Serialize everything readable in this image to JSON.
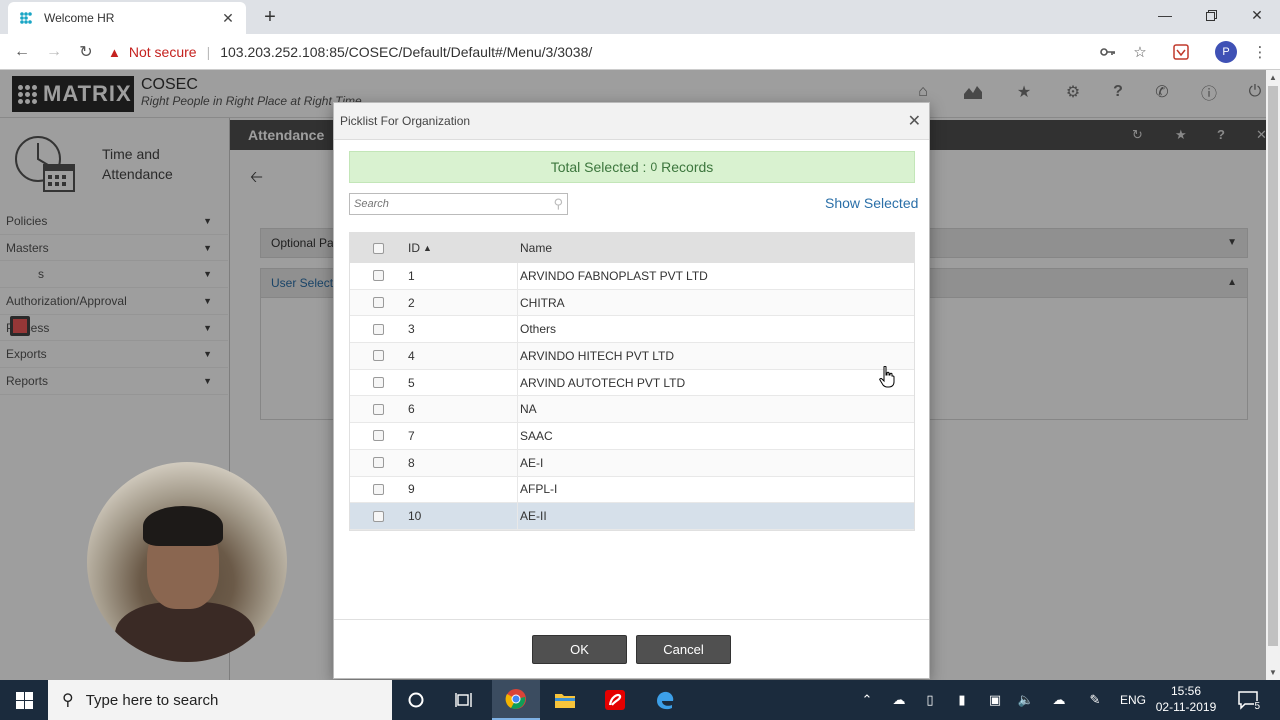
{
  "browser": {
    "tab_title": "Welcome HR",
    "security_label": "Not secure",
    "url_host": "103.203.252.108",
    "url_rest": ":85/COSEC/Default/Default#/Menu/3/3038/",
    "profile_initial": "P"
  },
  "app": {
    "logo_text": "MATRIX",
    "brand_name": "COSEC",
    "brand_tagline": "Right People in Right Place at Right Time",
    "module_title_1": "Time and",
    "module_title_2": "Attendance",
    "page_title": "Attendance",
    "menu": [
      {
        "label": "Policies"
      },
      {
        "label": "Masters"
      },
      {
        "label": "s"
      },
      {
        "label": "Authorization/Approval"
      },
      {
        "label": "Process"
      },
      {
        "label": "Exports"
      },
      {
        "label": "Reports"
      }
    ],
    "section_optional": "Optional Pa",
    "section_user": "User Selecti"
  },
  "modal": {
    "title": "Picklist For Organization",
    "selected_prefix": "Total Selected :",
    "selected_count": "0",
    "selected_suffix": "Records",
    "search_placeholder": "Search",
    "show_selected": "Show Selected",
    "col_id": "ID",
    "col_name": "Name",
    "rows": [
      {
        "id": "1",
        "name": "ARVINDO FABNOPLAST PVT LTD"
      },
      {
        "id": "2",
        "name": "CHITRA"
      },
      {
        "id": "3",
        "name": "Others"
      },
      {
        "id": "4",
        "name": "ARVINDO HITECH PVT LTD"
      },
      {
        "id": "5",
        "name": "ARVIND AUTOTECH PVT LTD"
      },
      {
        "id": "6",
        "name": "NA"
      },
      {
        "id": "7",
        "name": "SAAC"
      },
      {
        "id": "8",
        "name": "AE-I"
      },
      {
        "id": "9",
        "name": "AFPL-I"
      },
      {
        "id": "10",
        "name": "AE-II"
      }
    ],
    "ok_label": "OK",
    "cancel_label": "Cancel"
  },
  "taskbar": {
    "search_placeholder": "Type here to search",
    "language": "ENG",
    "time": "15:56",
    "date": "02-11-2019",
    "notification_count": "5"
  },
  "colors": {
    "accent_blue": "#2a6fa8",
    "banner_green": "#d9f2d0",
    "button_dark": "#505050",
    "not_secure_red": "#c5221f"
  }
}
